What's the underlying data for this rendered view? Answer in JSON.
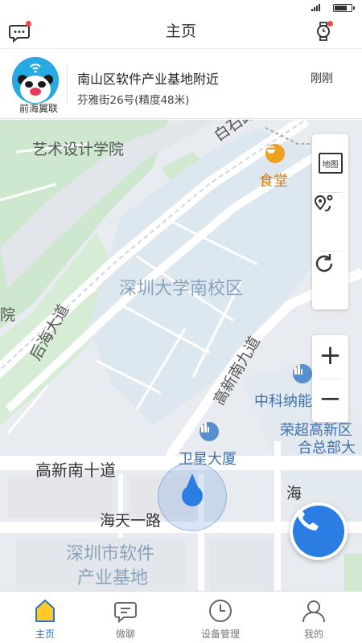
{
  "header": {
    "title": "主页"
  },
  "location": {
    "device_name": "前海翼联",
    "address": "南山区软件产业基地附近",
    "street": "芬雅街26号(精度48米)",
    "time": "刚刚"
  },
  "map": {
    "labels": {
      "art_school": "艺术设计学院",
      "baishi_road": "白石路",
      "canteen": "食堂",
      "szu_south": "深圳大学南校区",
      "houhai_avenue": "后海大道",
      "yuan_partial": "院",
      "gaoxin_9th": "高新南九道",
      "casc": "中科纳能",
      "rongchao": "荣超高新区",
      "rongchao_2": "合总部大",
      "weixing": "卫星大厦",
      "gaoxin_10th": "高新南十道",
      "haitian_1st": "海天一路",
      "software_base": "深圳市软件",
      "software_base_2": "产业基地",
      "hai_partial": "海"
    },
    "controls": {
      "map_type_label": "地图",
      "zoom_in": "+",
      "zoom_out": "−"
    },
    "icons": [
      "map-type-icon",
      "route-icon",
      "refresh-icon",
      "phone-icon",
      "location-marker-icon"
    ]
  },
  "tabs": [
    {
      "label": "主页",
      "icon": "home-icon",
      "active": true
    },
    {
      "label": "微聊",
      "icon": "chat-icon",
      "active": false
    },
    {
      "label": "设备管理",
      "icon": "clock-icon",
      "active": false
    },
    {
      "label": "我的",
      "icon": "user-icon",
      "active": false
    }
  ],
  "colors": {
    "accent": "#2c74c8",
    "call_button": "#2b7de3",
    "notification_dot": "#f04848",
    "active_tab_icon": "#ffc928"
  }
}
